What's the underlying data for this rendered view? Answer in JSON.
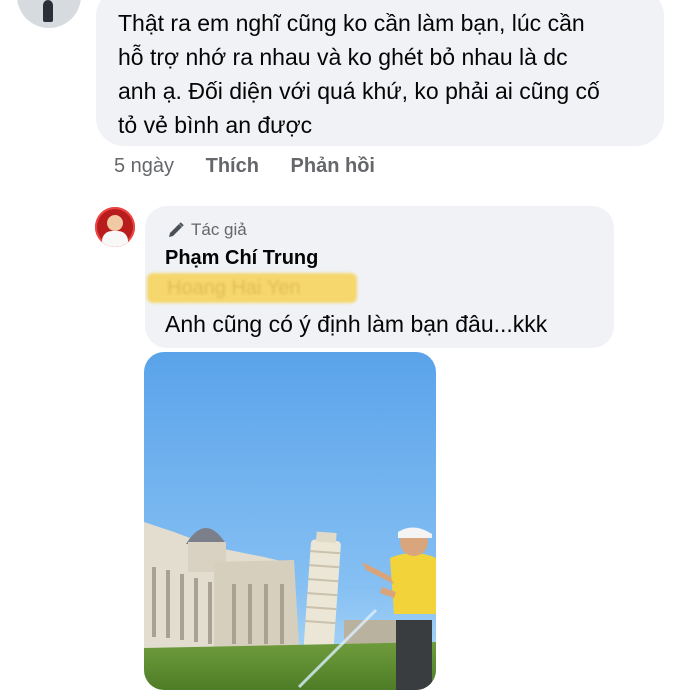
{
  "comment1": {
    "text": "Thật ra em nghĩ cũng ko cần làm bạn, lúc cần\nhỗ trợ nhớ ra nhau và ko ghét bỏ nhau là dc\nanh ạ. Đối diện với quá khứ, ko phải ai cũng cố\ntỏ vẻ bình an được",
    "time": "5 ngày",
    "like_label": "Thích",
    "reply_label": "Phản hồi"
  },
  "reply": {
    "badge_icon": "pencil-icon",
    "badge": "Tác giả",
    "author": "Phạm Chí Trung",
    "tagged_name": "Hoang Hai Yen",
    "text": "Anh cũng có ý định làm bạn đâu...kkk"
  },
  "photo": {
    "description": "man in yellow shirt posing near Leaning Tower of Pisa"
  },
  "colors": {
    "bubble": "#f0f2f5",
    "secondary_text": "#65676b",
    "highlight": "#f5d76e"
  }
}
